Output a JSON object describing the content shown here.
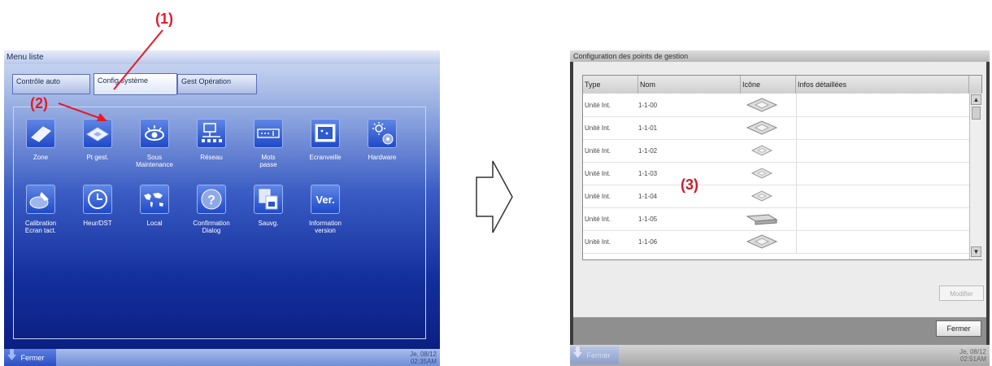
{
  "left": {
    "window_title": "Menu liste",
    "tabs": [
      "Contrôle\nauto",
      "Config système",
      "Gest Opération"
    ],
    "icons": [
      {
        "label": "Zone",
        "icon": "zone-icon"
      },
      {
        "label": "Pt gest.",
        "icon": "management-point-icon"
      },
      {
        "label": "Sous\nMaintenance",
        "icon": "eye-icon"
      },
      {
        "label": "Réseau",
        "icon": "network-icon"
      },
      {
        "label": "Mots\npasse",
        "icon": "password-icon"
      },
      {
        "label": "Ecranveille",
        "icon": "screensaver-icon"
      },
      {
        "label": "Hardware",
        "icon": "hardware-icon"
      },
      {
        "label": "Calibration\nEcran tact.",
        "icon": "touch-calibration-icon"
      },
      {
        "label": "Heur/DST",
        "icon": "clock-icon"
      },
      {
        "label": "Local",
        "icon": "world-map-icon"
      },
      {
        "label": "Confirmation\nDialog",
        "icon": "question-icon"
      },
      {
        "label": "Sauvg.",
        "icon": "save-icon"
      },
      {
        "label": "Information\nversion",
        "icon": "version-icon"
      }
    ],
    "close_label": "Fermer",
    "date": "Je, 08/12",
    "time": "02:35AM"
  },
  "right": {
    "window_title": "Configuration des points de gestion",
    "columns": [
      "Type",
      "Nom",
      "Icône",
      "Infos détaillées"
    ],
    "rows": [
      {
        "type": "Unité Int.",
        "name": "1-1-00",
        "icon": "cassette-unit-icon"
      },
      {
        "type": "Unité Int.",
        "name": "1-1-01",
        "icon": "cassette-unit-icon"
      },
      {
        "type": "Unité Int.",
        "name": "1-1-02",
        "icon": "cassette-unit-icon"
      },
      {
        "type": "Unité Int.",
        "name": "1-1-03",
        "icon": "cassette-unit-icon"
      },
      {
        "type": "Unité Int.",
        "name": "1-1-04",
        "icon": "cassette-unit-icon"
      },
      {
        "type": "Unité Int.",
        "name": "1-1-05",
        "icon": "ceiling-unit-icon"
      },
      {
        "type": "Unité Int.",
        "name": "1-1-06",
        "icon": "cassette-unit-icon"
      }
    ],
    "modify_label": "Modifier",
    "close_label": "Fermer",
    "bottom_close_label": "Fermer",
    "date": "Je, 08/12",
    "time": "02:51AM"
  },
  "callouts": [
    "(1)",
    "(2)",
    "(3)"
  ],
  "colors": {
    "callout": "#e6192a",
    "left_bg": "#0e2a8e",
    "right_bg": "#3c3c3c"
  }
}
